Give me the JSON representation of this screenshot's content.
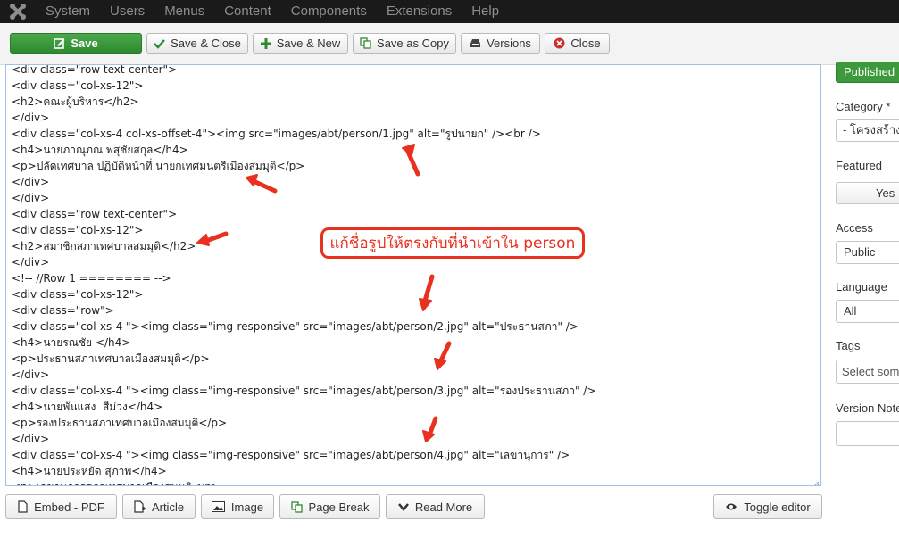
{
  "menu": {
    "logo_icon": "joomla-logo-icon",
    "items": [
      "System",
      "Users",
      "Menus",
      "Content",
      "Components",
      "Extensions",
      "Help"
    ]
  },
  "toolbar": {
    "save": "Save",
    "save_close": "Save & Close",
    "save_new": "Save & New",
    "save_copy": "Save as Copy",
    "versions": "Versions",
    "close": "Close"
  },
  "editor": {
    "lines": [
      "<div class=\"row text-center\">",
      "<div class=\"col-xs-12\">",
      "<h2>คณะผู้บริหาร</h2>",
      "</div>",
      "<div class=\"col-xs-4 col-xs-offset-4\"><img src=\"images/abt/person/1.jpg\" alt=\"รูปนายก\" /><br />",
      "<h4>นายภาณุภณ พสุชัยสกุล</h4>",
      "<p>ปลัดเทศบาล ปฏิบัติหน้าที่ นายกเทศมนตรีเมืองสมมุติ</p>",
      "</div>",
      "</div>",
      "<div class=\"row text-center\">",
      "<div class=\"col-xs-12\">",
      "<h2>สมาชิกสภาเทศบาลสมมุติ</h2>",
      "</div>",
      "<!-- //Row 1 ======== -->",
      "<div class=\"col-xs-12\">",
      "<div class=\"row\">",
      "<div class=\"col-xs-4 \"><img class=\"img-responsive\" src=\"images/abt/person/2.jpg\" alt=\"ประธานสภา\" />",
      "<h4>นายรณชัย </h4>",
      "<p>ประธานสภาเทศบาลเมืองสมมุติ</p>",
      "</div>",
      "<div class=\"col-xs-4 \"><img class=\"img-responsive\" src=\"images/abt/person/3.jpg\" alt=\"รองประธานสภา\" />",
      "<h4>นายพันแสง  สีม่วง</h4>",
      "<p>รองประธานสภาเทศบาลเมืองสมมุติ</p>",
      "</div>",
      "<div class=\"col-xs-4 \"><img class=\"img-responsive\" src=\"images/abt/person/4.jpg\" alt=\"เลขานุการ\" />",
      "<h4>นายประหยัด สุภาพ</h4>",
      "<p>เลขานุการสภาเทศบาลเมืองสมมุติ</p>"
    ]
  },
  "annotation": {
    "text": "แก้ชื่อรูปให้ตรงกับที่นำเข้าใน person",
    "color": "#e8311f"
  },
  "bottom": {
    "embed_pdf": "Embed - PDF",
    "article": "Article",
    "image": "Image",
    "page_break": "Page Break",
    "read_more": "Read More",
    "toggle_editor": "Toggle editor"
  },
  "sidebar": {
    "status": "Published",
    "category_label": "Category *",
    "category_value": "- โครงสร้าง",
    "featured_label": "Featured",
    "featured_value": "Yes",
    "access_label": "Access",
    "access_value": "Public",
    "language_label": "Language",
    "language_value": "All",
    "tags_label": "Tags",
    "tags_placeholder": "Select some",
    "version_note_label": "Version Note"
  }
}
